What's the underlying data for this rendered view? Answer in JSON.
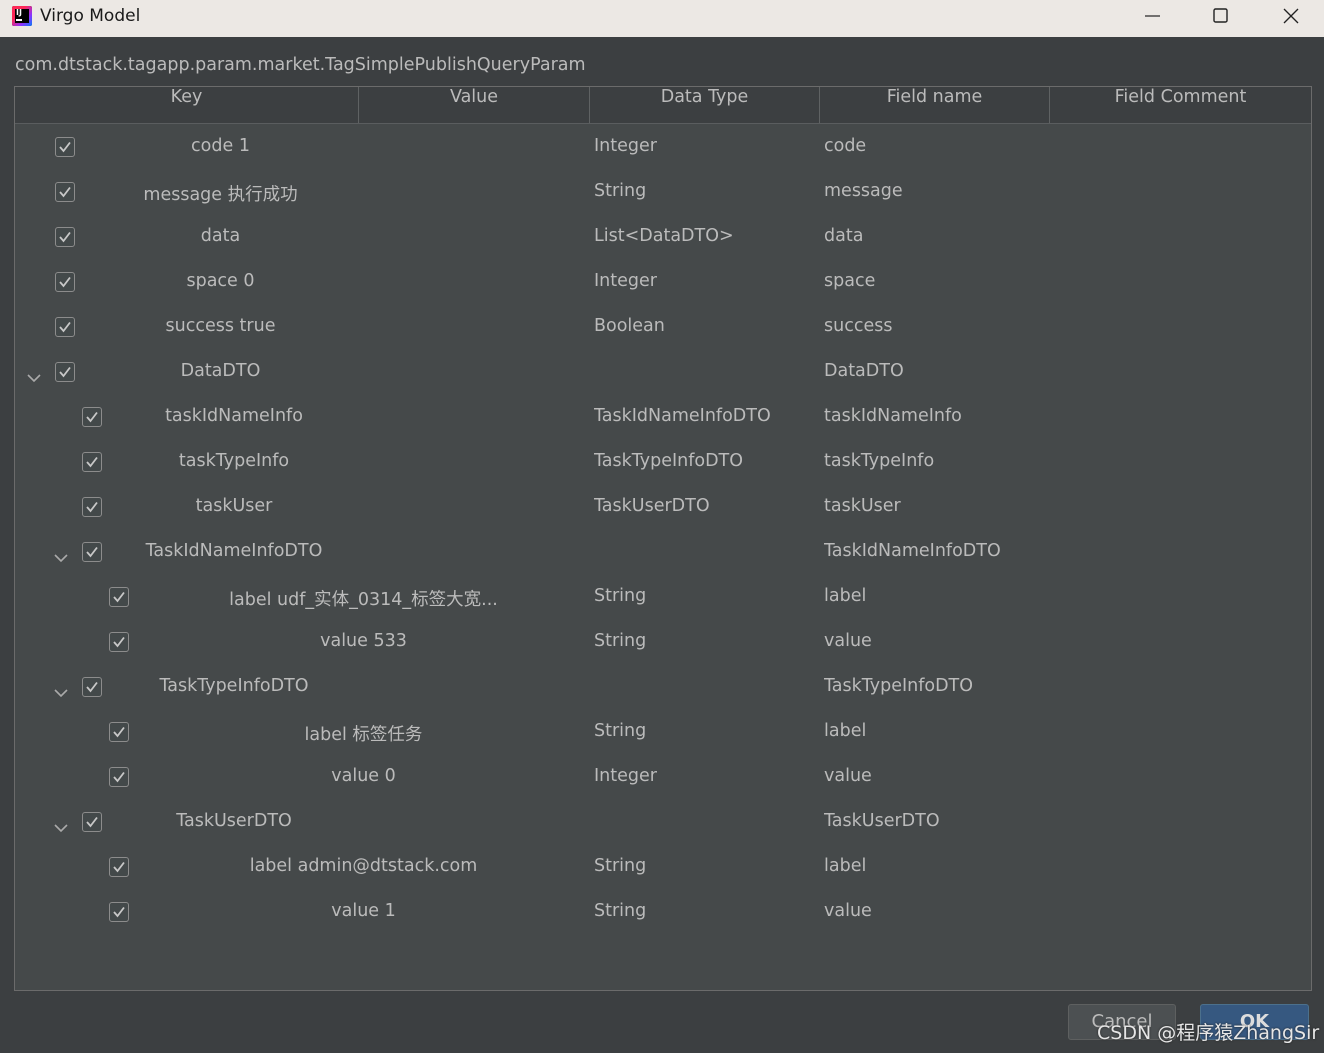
{
  "window": {
    "title": "Virgo Model"
  },
  "class_name": "com.dtstack.tagapp.param.market.TagSimplePublishQueryParam",
  "columns": [
    "Key",
    "Value",
    "Data Type",
    "Field name",
    "Field Comment"
  ],
  "rows": [
    {
      "key": "code 1",
      "data_type": "Integer",
      "field_name": "code",
      "checked": true,
      "level": 0,
      "expandable": false
    },
    {
      "key": "message 执行成功",
      "data_type": "String",
      "field_name": "message",
      "checked": true,
      "level": 0,
      "expandable": false
    },
    {
      "key": "data",
      "data_type": "List<DataDTO>",
      "field_name": "data",
      "checked": true,
      "level": 0,
      "expandable": false
    },
    {
      "key": "space 0",
      "data_type": "Integer",
      "field_name": "space",
      "checked": true,
      "level": 0,
      "expandable": false
    },
    {
      "key": "success true",
      "data_type": "Boolean",
      "field_name": "success",
      "checked": true,
      "level": 0,
      "expandable": false
    },
    {
      "key": "DataDTO",
      "data_type": "",
      "field_name": "DataDTO",
      "checked": true,
      "level": 0,
      "expandable": true
    },
    {
      "key": "taskIdNameInfo",
      "data_type": "TaskIdNameInfoDTO",
      "field_name": "taskIdNameInfo",
      "checked": true,
      "level": 1,
      "expandable": false
    },
    {
      "key": "taskTypeInfo",
      "data_type": "TaskTypeInfoDTO",
      "field_name": "taskTypeInfo",
      "checked": true,
      "level": 1,
      "expandable": false
    },
    {
      "key": "taskUser",
      "data_type": "TaskUserDTO",
      "field_name": "taskUser",
      "checked": true,
      "level": 1,
      "expandable": false
    },
    {
      "key": "TaskIdNameInfoDTO",
      "data_type": "",
      "field_name": "TaskIdNameInfoDTO",
      "checked": true,
      "level": 1,
      "expandable": true
    },
    {
      "key": "label udf_实体_0314_标签大宽...",
      "data_type": "String",
      "field_name": "label",
      "checked": true,
      "level": 2,
      "expandable": false
    },
    {
      "key": "value 533",
      "data_type": "String",
      "field_name": "value",
      "checked": true,
      "level": 2,
      "expandable": false
    },
    {
      "key": "TaskTypeInfoDTO",
      "data_type": "",
      "field_name": "TaskTypeInfoDTO",
      "checked": true,
      "level": 1,
      "expandable": true
    },
    {
      "key": "label 标签任务",
      "data_type": "String",
      "field_name": "label",
      "checked": true,
      "level": 2,
      "expandable": false
    },
    {
      "key": "value 0",
      "data_type": "Integer",
      "field_name": "value",
      "checked": true,
      "level": 2,
      "expandable": false
    },
    {
      "key": "TaskUserDTO",
      "data_type": "",
      "field_name": "TaskUserDTO",
      "checked": true,
      "level": 1,
      "expandable": true
    },
    {
      "key": "label admin@dtstack.com",
      "data_type": "String",
      "field_name": "label",
      "checked": true,
      "level": 2,
      "expandable": false
    },
    {
      "key": "value 1",
      "data_type": "String",
      "field_name": "value",
      "checked": true,
      "level": 2,
      "expandable": false
    }
  ],
  "buttons": {
    "cancel": "Cancel",
    "ok": "OK"
  },
  "watermark": "CSDN @程序猿ZhangSir",
  "icons": {
    "app": "intellij-idea-icon",
    "minimize": "minimize-icon",
    "maximize": "maximize-icon",
    "close": "close-icon",
    "expand": "chevron-down-icon",
    "check": "checkmark-icon"
  }
}
